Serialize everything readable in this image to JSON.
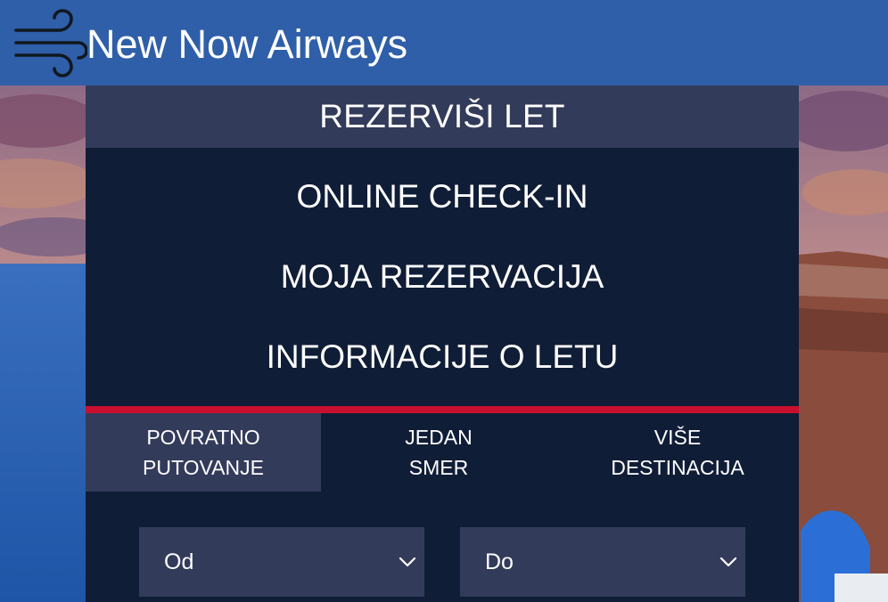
{
  "header": {
    "brand_name": "New Now Airways",
    "logo_icon": "wind-icon",
    "background_color": "#2f5fa9"
  },
  "nav": {
    "active_item": "REZERVIŠI LET",
    "items": [
      "ONLINE CHECK-IN",
      "MOJA REZERVACIJA",
      "INFORMACIJE O LETU"
    ]
  },
  "trip_types": [
    {
      "line1": "POVRATNO",
      "line2": "PUTOVANJE",
      "selected": true
    },
    {
      "line1": "JEDAN",
      "line2": "SMER",
      "selected": false
    },
    {
      "line1": "VIŠE",
      "line2": "DESTINACIJA",
      "selected": false
    }
  ],
  "fields": {
    "from": {
      "value": "Od",
      "icon": "chevron-down-icon"
    },
    "to": {
      "value": "Do",
      "icon": "chevron-down-icon"
    }
  },
  "colors": {
    "panel": "#101d37",
    "active": "#333b5b",
    "accent": "#c8102e"
  }
}
